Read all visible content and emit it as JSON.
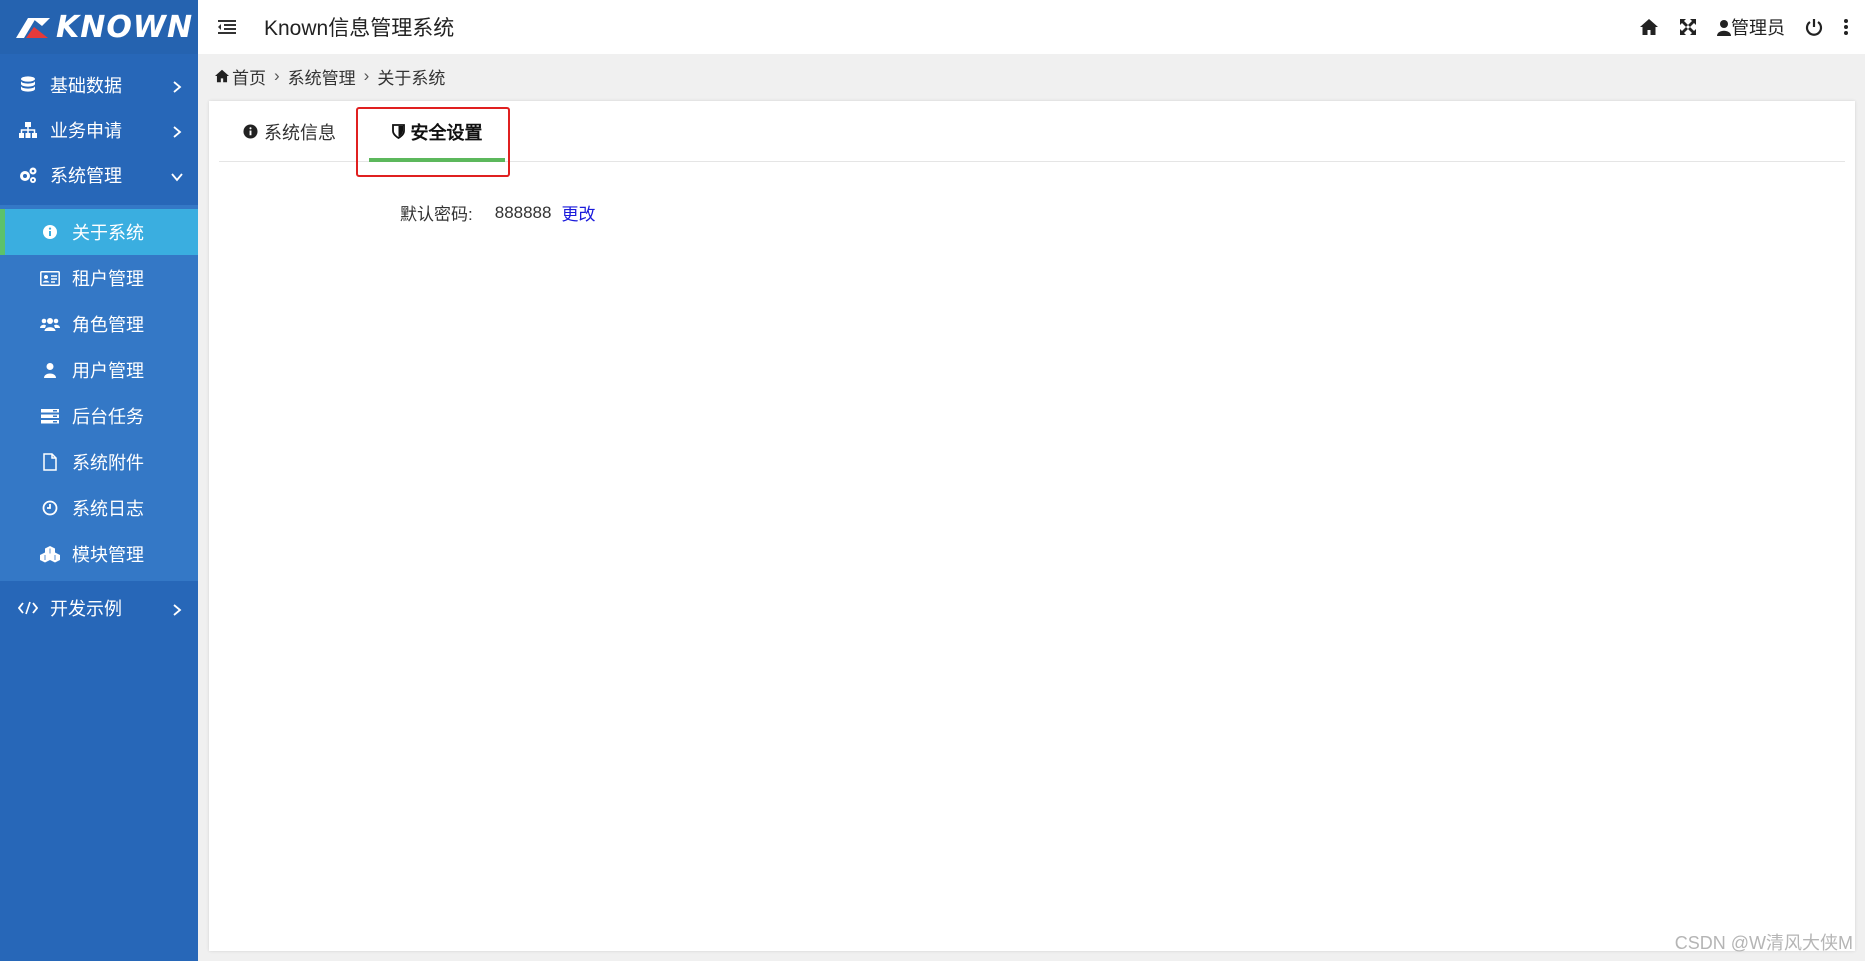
{
  "brand": {
    "logo_text": "KNOWN"
  },
  "header": {
    "app_title": "Known信息管理系统",
    "user_label": "管理员"
  },
  "sidebar": {
    "items": [
      {
        "label": "基础数据",
        "icon": "database-icon",
        "expanded": false
      },
      {
        "label": "业务申请",
        "icon": "sitemap-icon",
        "expanded": false
      },
      {
        "label": "系统管理",
        "icon": "gears-icon",
        "expanded": true
      },
      {
        "label": "开发示例",
        "icon": "code-icon",
        "expanded": false
      }
    ],
    "submenu": [
      {
        "label": "关于系统",
        "icon": "info-circle-icon",
        "active": true
      },
      {
        "label": "租户管理",
        "icon": "id-card-icon"
      },
      {
        "label": "角色管理",
        "icon": "users-icon"
      },
      {
        "label": "用户管理",
        "icon": "user-icon"
      },
      {
        "label": "后台任务",
        "icon": "tasks-icon"
      },
      {
        "label": "系统附件",
        "icon": "file-icon"
      },
      {
        "label": "系统日志",
        "icon": "clock-icon"
      },
      {
        "label": "模块管理",
        "icon": "cubes-icon"
      }
    ]
  },
  "breadcrumb": {
    "home": "首页",
    "section": "系统管理",
    "current": "关于系统"
  },
  "tabs": [
    {
      "label": "系统信息",
      "icon": "info-circle-icon",
      "active": false
    },
    {
      "label": "安全设置",
      "icon": "shield-icon",
      "active": true
    }
  ],
  "security": {
    "default_password_label": "默认密码:",
    "default_password_value": "888888",
    "change_link": "更改"
  },
  "watermark": "CSDN @W清风大侠M",
  "colors": {
    "sidebar_bg": "#2767b8",
    "submenu_bg": "#3478c6",
    "active_item_bg": "#3aaee0",
    "active_indicator": "#5cc26a",
    "tab_underline": "#5cb85c",
    "highlight_border": "#e02020",
    "link": "#1a1adb"
  }
}
